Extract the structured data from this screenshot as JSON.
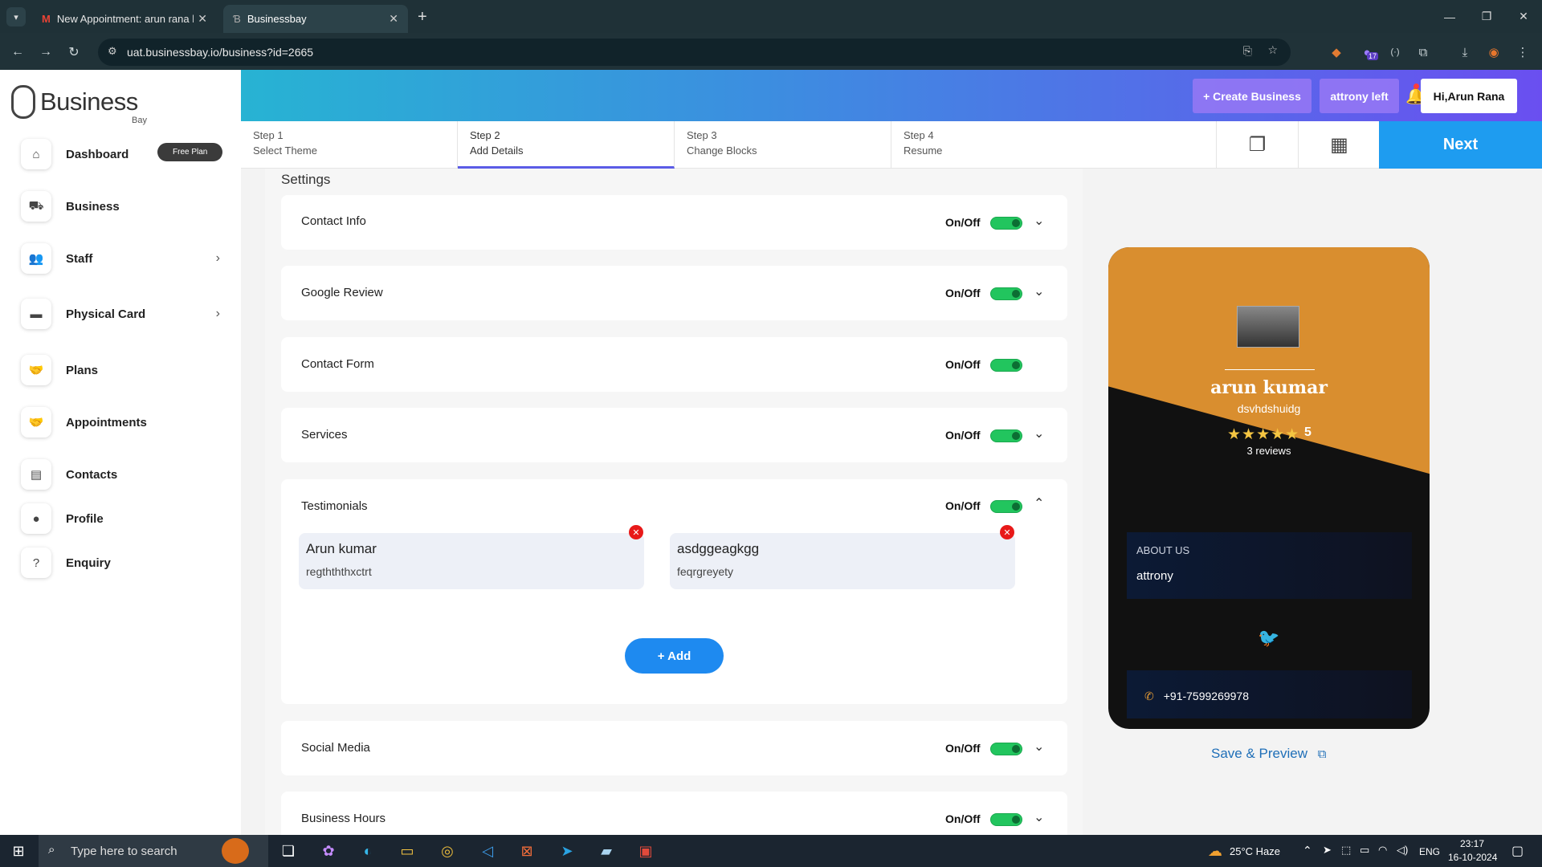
{
  "browser": {
    "tabs": [
      {
        "title": "New Appointment: arun rana h"
      },
      {
        "title": "Businessbay"
      }
    ],
    "url": "uat.businessbay.io/business?id=2665",
    "ext_badge": "17"
  },
  "sidebar": {
    "logo_text": "Business",
    "logo_sub": "Bay",
    "free_plan": "Free Plan",
    "items": [
      {
        "label": "Dashboard"
      },
      {
        "label": "Business"
      },
      {
        "label": "Staff"
      },
      {
        "label": "Physical Card"
      },
      {
        "label": "Plans"
      },
      {
        "label": "Appointments"
      },
      {
        "label": "Contacts"
      },
      {
        "label": "Profile"
      },
      {
        "label": "Enquiry"
      }
    ]
  },
  "header": {
    "create_business": "+ Create Business",
    "attrony_left": "attrony left",
    "user": "Hi,Arun Rana"
  },
  "steps": [
    {
      "step": "Step 1",
      "label": "Select Theme"
    },
    {
      "step": "Step 2",
      "label": "Add Details"
    },
    {
      "step": "Step 3",
      "label": "Change Blocks"
    },
    {
      "step": "Step 4",
      "label": "Resume"
    }
  ],
  "next_label": "Next",
  "settings": {
    "title": "Settings",
    "onoff_label": "On/Off",
    "sections": [
      {
        "title": "Contact Info",
        "enabled": true
      },
      {
        "title": "Google Review",
        "enabled": true
      },
      {
        "title": "Contact Form",
        "enabled": true
      },
      {
        "title": "Services",
        "enabled": true
      },
      {
        "title": "Testimonials",
        "enabled": true
      },
      {
        "title": "Social Media",
        "enabled": true
      },
      {
        "title": "Business Hours",
        "enabled": true
      }
    ],
    "testimonials": [
      {
        "name": "Arun kumar",
        "text": "regthththxctrt"
      },
      {
        "name": "asdggeagkgg",
        "text": "feqrgreyety"
      }
    ],
    "add_label": "+ Add"
  },
  "preview": {
    "name": "arun kumar",
    "subtitle": "dsvhdshuidg",
    "rating": "5",
    "reviews": "3 reviews",
    "about_heading": "ABOUT US",
    "about_text": "attrony",
    "phone": "+91-7599269978",
    "save_preview": "Save & Preview"
  },
  "taskbar": {
    "search_placeholder": "Type here to search",
    "weather": "25°C  Haze",
    "lang": "ENG",
    "time": "23:17",
    "date": "16-10-2024"
  }
}
